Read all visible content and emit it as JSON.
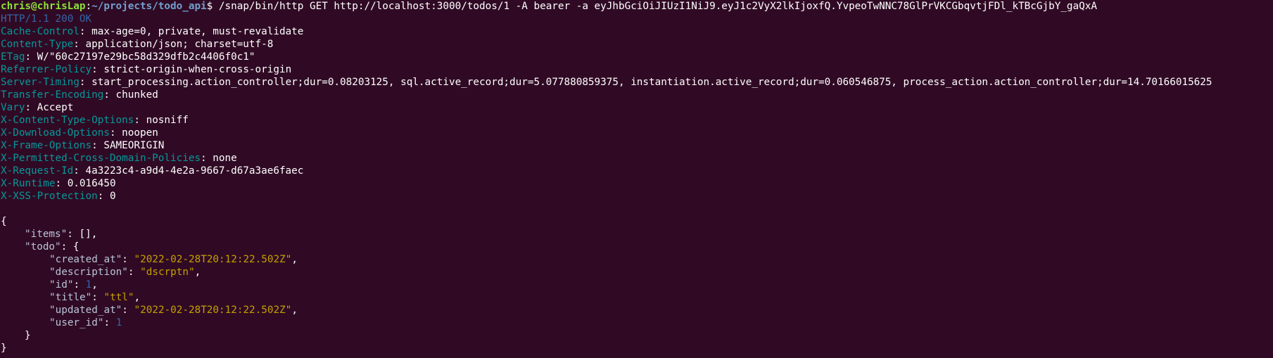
{
  "prompt": {
    "user_host": "chris@chrisLap",
    "separator": ":",
    "path": "~/projects/todo_api",
    "symbol": "$ ",
    "command": "/snap/bin/http GET http://localhost:3000/todos/1 -A bearer -a eyJhbGciOiJIUzI1NiJ9.eyJ1c2VyX2lkIjoxfQ.YvpeoTwNNC78GlPrVKCGbqvtjFDl_kTBcGjbY_gaQxA"
  },
  "status": {
    "protocol": "HTTP",
    "version": "/1.1 200",
    "reason": " OK"
  },
  "headers": [
    {
      "name": "Cache-Control",
      "value": "max-age=0, private, must-revalidate"
    },
    {
      "name": "Content-Type",
      "value": "application/json; charset=utf-8"
    },
    {
      "name": "ETag",
      "value": "W/\"60c27197e29bc58d329dfb2c4406f0c1\""
    },
    {
      "name": "Referrer-Policy",
      "value": "strict-origin-when-cross-origin"
    },
    {
      "name": "Server-Timing",
      "value": "start_processing.action_controller;dur=0.08203125, sql.active_record;dur=5.077880859375, instantiation.active_record;dur=0.060546875, process_action.action_controller;dur=14.70166015625"
    },
    {
      "name": "Transfer-Encoding",
      "value": "chunked"
    },
    {
      "name": "Vary",
      "value": "Accept"
    },
    {
      "name": "X-Content-Type-Options",
      "value": "nosniff"
    },
    {
      "name": "X-Download-Options",
      "value": "noopen"
    },
    {
      "name": "X-Frame-Options",
      "value": "SAMEORIGIN"
    },
    {
      "name": "X-Permitted-Cross-Domain-Policies",
      "value": "none"
    },
    {
      "name": "X-Request-Id",
      "value": "4a3223c4-a9d4-4e2a-9667-d67a3ae6faec"
    },
    {
      "name": "X-Runtime",
      "value": "0.016450"
    },
    {
      "name": "X-XSS-Protection",
      "value": "0"
    }
  ],
  "body": {
    "open_brace": "{",
    "close_brace": "}",
    "items_key": "\"items\"",
    "items_value": "[]",
    "todo_key": "\"todo\"",
    "todo_open": "{",
    "todo_close": "}",
    "fields": [
      {
        "key": "\"created_at\"",
        "value": "\"2022-02-28T20:12:22.502Z\"",
        "type": "str",
        "comma": ","
      },
      {
        "key": "\"description\"",
        "value": "\"dscrptn\"",
        "type": "str",
        "comma": ","
      },
      {
        "key": "\"id\"",
        "value": "1",
        "type": "num",
        "comma": ","
      },
      {
        "key": "\"title\"",
        "value": "\"ttl\"",
        "type": "str",
        "comma": ","
      },
      {
        "key": "\"updated_at\"",
        "value": "\"2022-02-28T20:12:22.502Z\"",
        "type": "str",
        "comma": ","
      },
      {
        "key": "\"user_id\"",
        "value": "1",
        "type": "num",
        "comma": ""
      }
    ]
  },
  "colors": {
    "background": "#300a24",
    "prompt_user": "#8ae234",
    "prompt_path": "#729fcf",
    "header_name": "#06989a",
    "json_string": "#c4a000",
    "json_number": "#3465a4"
  }
}
